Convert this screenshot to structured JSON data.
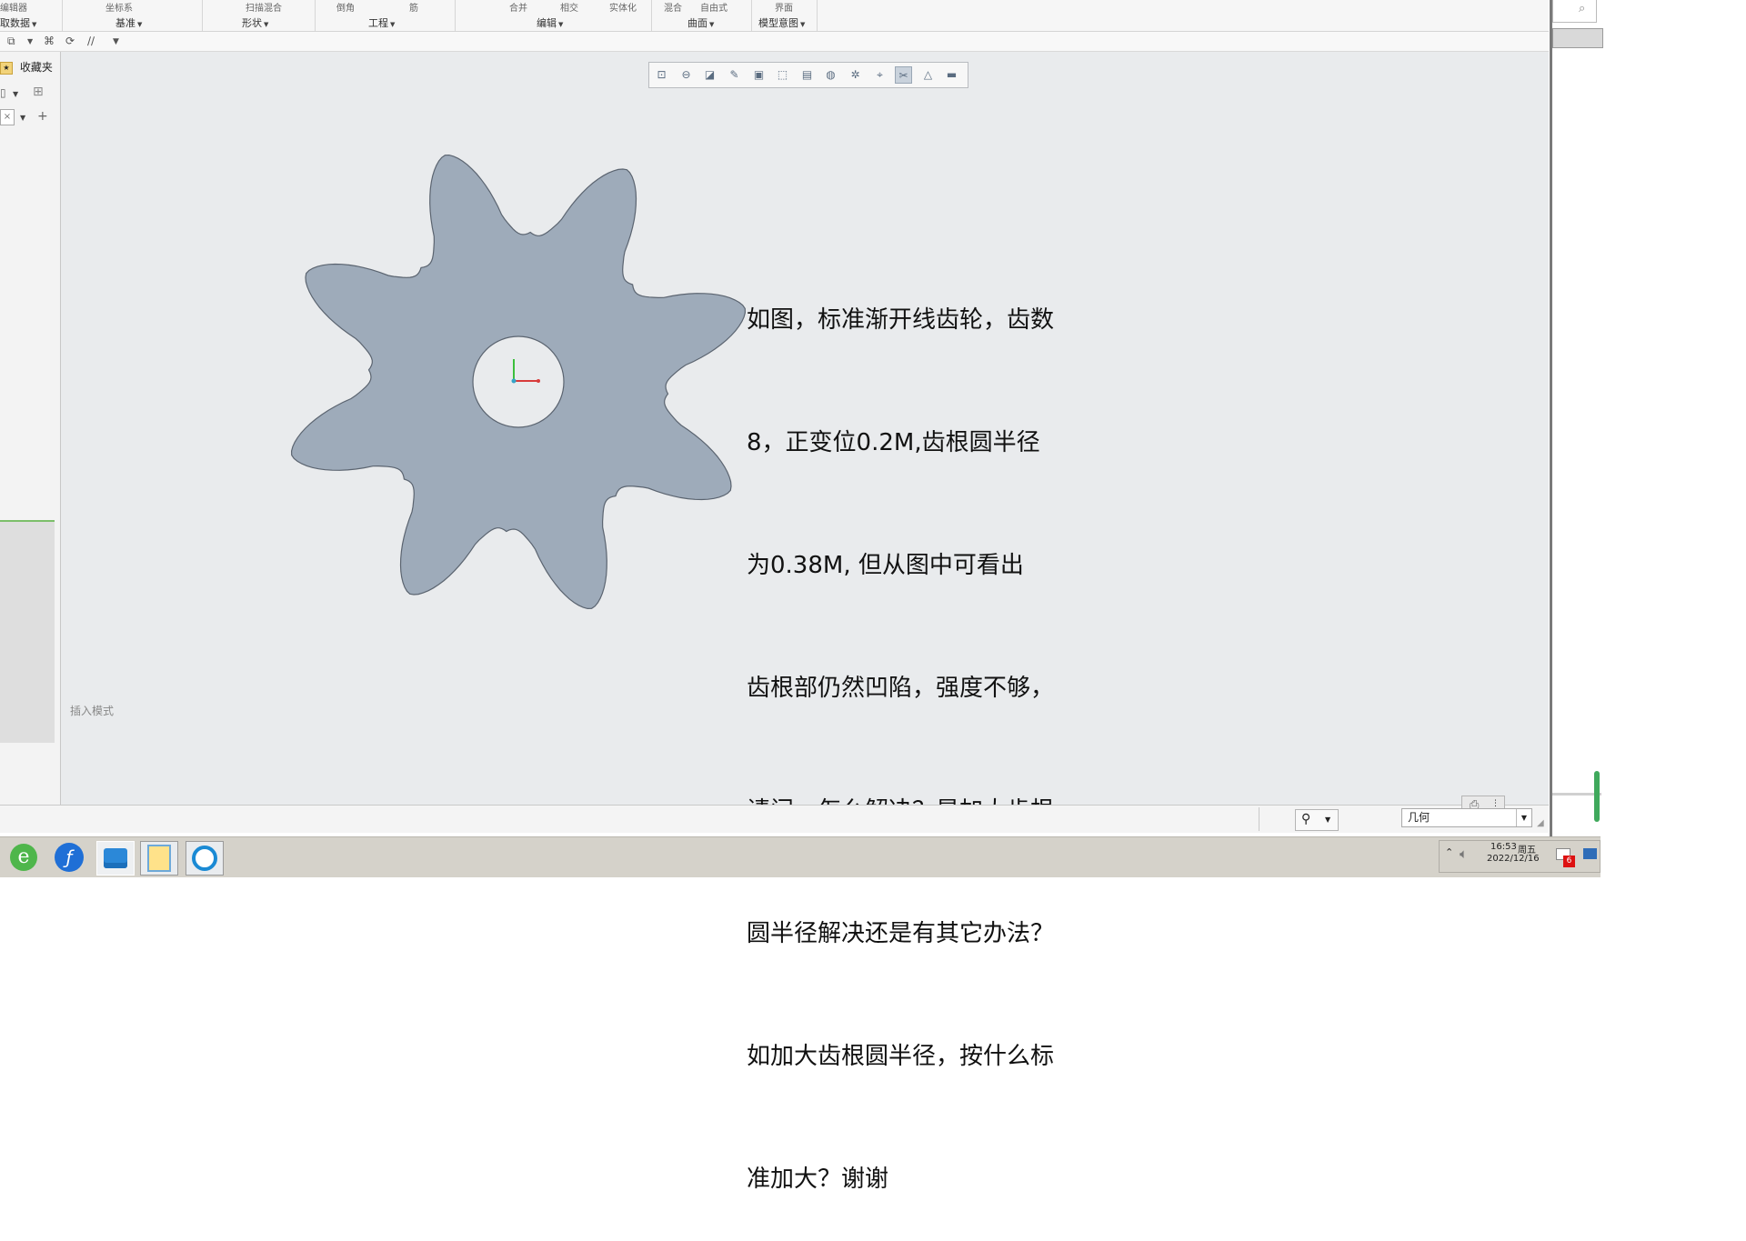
{
  "ribbon": {
    "top_labels": [
      "编辑器",
      "坐标系",
      "扫描混合",
      "倒角",
      "筋",
      "合并",
      "相交",
      "实体化",
      "混合",
      "自由式",
      "界面"
    ],
    "groups": [
      {
        "label": "取数据"
      },
      {
        "label": "基准"
      },
      {
        "label": "形状"
      },
      {
        "label": "工程"
      },
      {
        "label": "编辑"
      },
      {
        "label": "曲面"
      },
      {
        "label": "模型意图"
      }
    ]
  },
  "left_panel": {
    "favorites": "收藏夹"
  },
  "canvas": {
    "question": "如图，标准渐开线齿轮，齿数8，正变位0.2M,齿根圆半径为0.38M, 但从图中可看出齿根部仍然凹陷，强度不够，请问，怎么解决？是加大齿根圆半径解决还是有其它办法？如加大齿根圆半径，按什么标准加大？谢谢",
    "question_lines": [
      "如图，标准渐开线齿轮，齿数",
      "8，正变位0.2M,齿根圆半径",
      "为0.38M, 但从图中可看出",
      "齿根部仍然凹陷，强度不够，",
      "请问，怎么解决？是加大齿根",
      "圆半径解决还是有其它办法？",
      "如加大齿根圆半径，按什么标",
      "准加大？谢谢"
    ],
    "insert_mode": "插入模式",
    "gear": {
      "teeth": 8,
      "fill": "#9eabba",
      "bore_fill": "#e9ebed"
    }
  },
  "status": {
    "filter_value": "几何"
  },
  "taskbar": {
    "time": "16:53",
    "weekday": "周五",
    "date": "2022/12/16",
    "notify_count": "6"
  },
  "colors": {
    "canvas_bg": "#e9ebed",
    "gear": "#9eabba",
    "taskbar": "#d5d2ca"
  }
}
